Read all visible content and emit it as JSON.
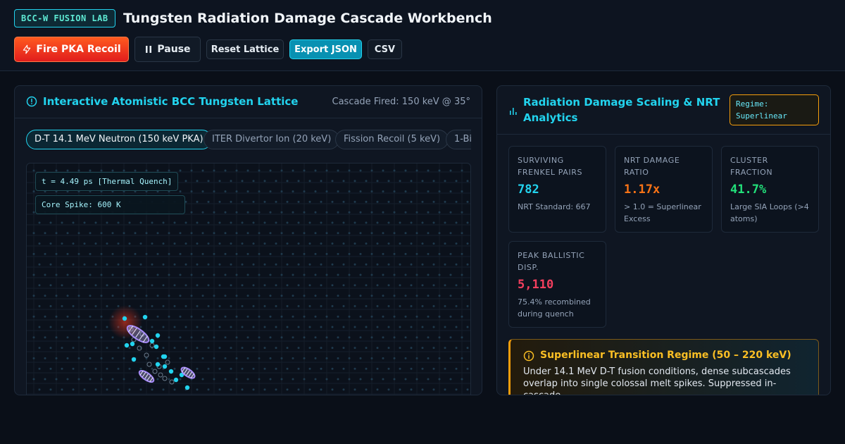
{
  "header": {
    "badge": "BCC-W FUSION LAB",
    "title": "Tungsten Radiation Damage Cascade Workbench"
  },
  "toolbar": {
    "fire_label": "Fire PKA Recoil",
    "pause_label": "Pause",
    "reset_label": "Reset Lattice",
    "export_label": "Export JSON",
    "csv_label": "CSV"
  },
  "lattice_panel": {
    "title": "Interactive Atomistic BCC Tungsten Lattice",
    "status": "Cascade Fired: 150 keV @ 35°",
    "presets": [
      {
        "label": "D-T 14.1 MeV Neutron (150 keV PKA)",
        "active": true
      },
      {
        "label": "ITER Divertor Ion (20 keV)",
        "active": false
      },
      {
        "label": "Fission Recoil (5 keV)",
        "active": false
      },
      {
        "label": "1-Bi",
        "active": false
      }
    ],
    "time_readout": "t = 4.49 ps [Thermal Quench]",
    "spike_readout": "Core Spike: 600 K"
  },
  "analytics_panel": {
    "title": "Radiation Damage Scaling & NRT Analytics",
    "regime": "Regime: Superlinear",
    "cards": [
      {
        "label": "Surviving Frenkel Pairs",
        "value": "782",
        "note": "NRT Standard: 667",
        "color": "#22d3ee"
      },
      {
        "label": "NRT Damage Ratio",
        "value": "1.17x",
        "note": "> 1.0 = Superlinear Excess",
        "color": "#f97316"
      },
      {
        "label": "Cluster Fraction",
        "value": "41.7%",
        "note": "Large SIA Loops (>4 atoms)",
        "color": "#22e07a"
      },
      {
        "label": "Peak Ballistic Disp.",
        "value": "5,110",
        "note": "75.4% recombined during quench",
        "color": "#f43f5e"
      }
    ],
    "callout": {
      "title": "Superlinear Transition Regime (50 – 220 keV)",
      "body": "Under 14.1 MeV D-T fusion conditions, dense subcascades overlap into single colossal melt spikes. Suppressed in-cascade"
    }
  },
  "colors": {
    "accent": "#22d3ee",
    "fire": "#ef4444",
    "warning": "#f59e0b"
  }
}
